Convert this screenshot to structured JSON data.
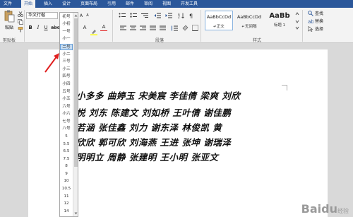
{
  "tabs": [
    "文件",
    "开始",
    "插入",
    "设计",
    "页面布局",
    "引用",
    "邮件",
    "审阅",
    "视图",
    "开发工具"
  ],
  "ribbon": {
    "paste_label": "粘贴",
    "clipboard_label": "剪贴板",
    "font_name": "华文行楷",
    "font_size": "四号",
    "paragraph_label": "段落",
    "styles_label": "样式",
    "style_items": [
      {
        "preview": "AaBbCcDd",
        "name": "↵正文"
      },
      {
        "preview": "AaBbCcDd",
        "name": "↵无间隔"
      },
      {
        "preview": "AaBb",
        "name": "标题 1"
      }
    ],
    "find_label": "查找",
    "replace_label": "替换",
    "select_label": "选择"
  },
  "font_size_list": [
    "初号",
    "小初",
    "一号",
    "小一",
    "二号",
    "小二",
    "三号",
    "小三",
    "四号",
    "小四",
    "五号",
    "小五",
    "六号",
    "小六",
    "七号",
    "八号",
    "5",
    "5.5",
    "6.5",
    "7.5",
    "8",
    "9",
    "10",
    "10.5",
    "11",
    "12",
    "14"
  ],
  "highlighted_size": "二号",
  "document_lines": [
    "小多多  曲婷玉  宋美宸  李佳倩  梁爽  刘欣",
    "悦  刘东  陈建文  刘如桥  王叶倩  谢佳鹏",
    "若涵  张佳鑫  刘力  谢东泽  林俊凯  黄",
    "欣欣  郭可欣  刘海燕  王进  张坤  谢瑞泽",
    "明明立  周静  张建明  王小明  张亚文"
  ],
  "watermark": {
    "text": "Baidu",
    "sub": "经验"
  }
}
